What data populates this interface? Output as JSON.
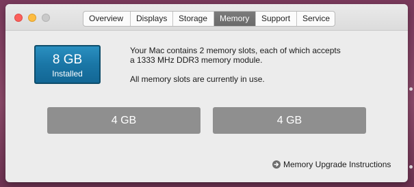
{
  "window": {
    "tabs": [
      {
        "label": "Overview"
      },
      {
        "label": "Displays"
      },
      {
        "label": "Storage"
      },
      {
        "label": "Memory"
      },
      {
        "label": "Support"
      },
      {
        "label": "Service"
      }
    ],
    "active_tab": "Memory"
  },
  "memory": {
    "installed_size": "8 GB",
    "installed_label": "Installed",
    "description_line1": "Your Mac contains 2 memory slots, each of which accepts",
    "description_line2": "a 1333 MHz DDR3 memory module.",
    "status": "All memory slots are currently in use.",
    "slots": [
      {
        "label": "4 GB"
      },
      {
        "label": "4 GB"
      }
    ],
    "upgrade_link": "Memory Upgrade Instructions"
  },
  "colors": {
    "installed_box": "#1a76a6",
    "slot_fill": "#8f8f8f",
    "active_tab": "#6f6f6f",
    "close_light": "#fc605c",
    "minimize_light": "#fdbc40"
  },
  "icons": {
    "upgrade_link": "arrow-circle-right-icon"
  }
}
